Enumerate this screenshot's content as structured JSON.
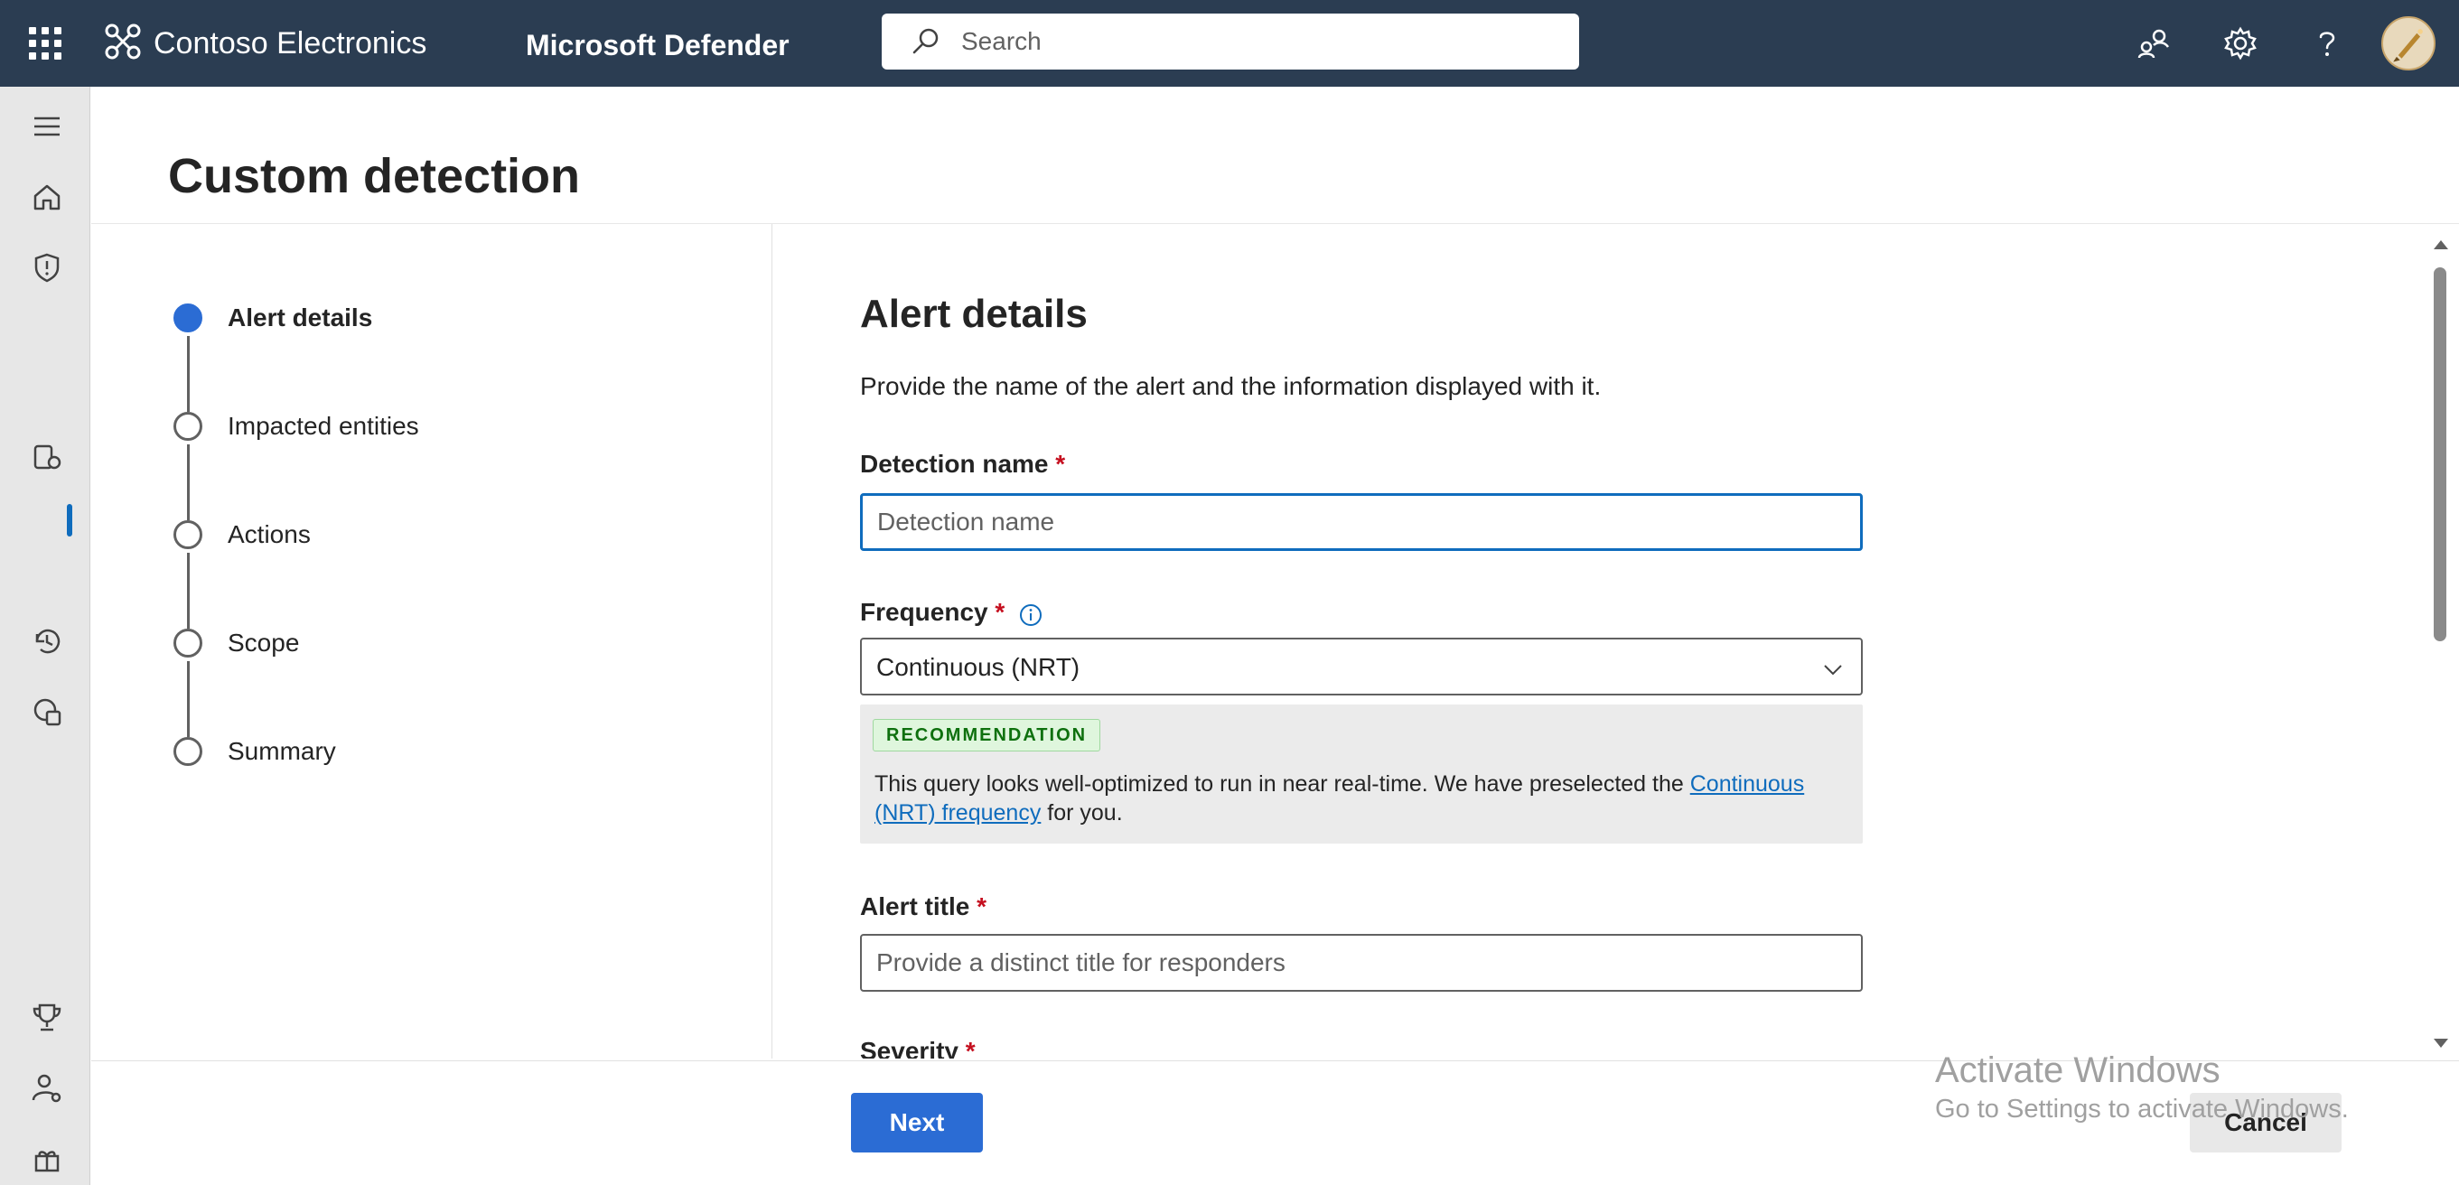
{
  "topbar": {
    "org_name": "Contoso Electronics",
    "product_name": "Microsoft Defender",
    "search_placeholder": "Search"
  },
  "page": {
    "title": "Custom detection"
  },
  "steps": [
    {
      "label": "Alert details",
      "state": "current"
    },
    {
      "label": "Impacted entities",
      "state": "pending"
    },
    {
      "label": "Actions",
      "state": "pending"
    },
    {
      "label": "Scope",
      "state": "pending"
    },
    {
      "label": "Summary",
      "state": "pending"
    }
  ],
  "form": {
    "section_title": "Alert details",
    "section_description": "Provide the name of the alert and the information displayed with it.",
    "required_marker": "*",
    "detection_name": {
      "label": "Detection name",
      "value": "",
      "placeholder": "Detection name"
    },
    "frequency": {
      "label": "Frequency",
      "selected": "Continuous (NRT)"
    },
    "recommendation": {
      "badge": "RECOMMENDATION",
      "text_before": "This query looks well-optimized to run in near real-time. We have preselected the ",
      "link": "Continuous (NRT) frequency",
      "text_after": " for you."
    },
    "alert_title": {
      "label": "Alert title",
      "value": "",
      "placeholder": "Provide a distinct title for responders"
    },
    "severity": {
      "label": "Severity"
    }
  },
  "footer": {
    "next_label": "Next",
    "cancel_label": "Cancel"
  },
  "watermark": {
    "title": "Activate Windows",
    "subtitle": "Go to Settings to activate Windows."
  },
  "colors": {
    "topbar": "#2b3d52",
    "accent": "#2b6cd4",
    "focus_border": "#0f6cbd",
    "required": "#c50f1f",
    "recommendation_bg": "#ebebeb",
    "badge_bg": "#dff6dd"
  },
  "icons": {
    "topbar": [
      "app-launcher-icon",
      "brand-icon",
      "search-icon",
      "community-icon",
      "gear-icon",
      "help-icon",
      "avatar"
    ],
    "rail": [
      "hamburger-icon",
      "home-icon",
      "shield-icon",
      "device-icon",
      "history-icon",
      "policy-icon",
      "trophy-icon",
      "user-settings-icon",
      "customize-icon"
    ]
  }
}
